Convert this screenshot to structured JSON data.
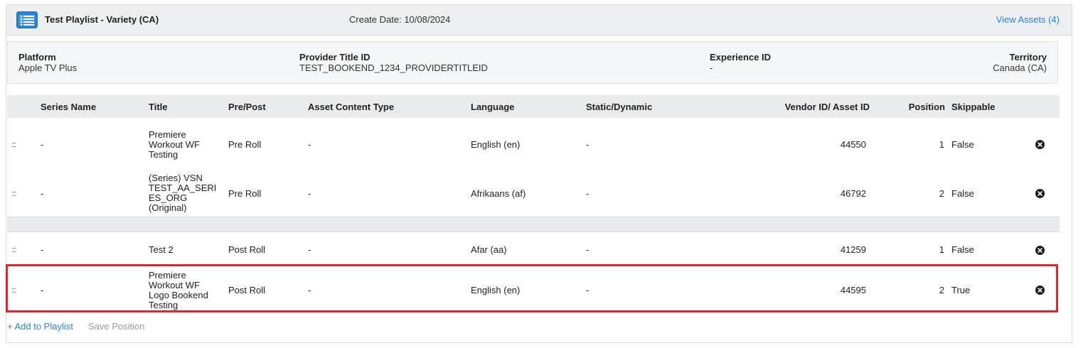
{
  "header": {
    "title": "Test Playlist - Variety (CA)",
    "create_date": "Create Date: 10/08/2024",
    "view_assets": "View Assets (4)",
    "icon": "list-icon",
    "accent_color": "#2a84d4"
  },
  "info": {
    "platform": {
      "label": "Platform",
      "value": "Apple TV Plus"
    },
    "provider_title_id": {
      "label": "Provider Title ID",
      "value": "TEST_BOOKEND_1234_PROVIDERTITLEID"
    },
    "experience_id": {
      "label": "Experience ID",
      "value": "-"
    },
    "territory": {
      "label": "Territory",
      "value": "Canada (CA)"
    }
  },
  "table": {
    "columns": {
      "series_name": "Series Name",
      "title": "Title",
      "pre_post": "Pre/Post",
      "asset_content_type": "Asset Content Type",
      "language": "Language",
      "static_dynamic": "Static/Dynamic",
      "vendor_asset_id": "Vendor ID/ Asset ID",
      "position": "Position",
      "skippable": "Skippable"
    },
    "rows": [
      {
        "handle": ":::",
        "series_name": "-",
        "title_lines": [
          "Premiere",
          "Workout WF",
          "Testing"
        ],
        "pre_post": "Pre Roll",
        "asset_content_type": "-",
        "language": "English (en)",
        "static_dynamic": "-",
        "vendor_asset_id": "44550",
        "position": "1",
        "skippable": "False"
      },
      {
        "handle": ":::",
        "series_name": "-",
        "title_lines": [
          "(Series) VSN",
          "TEST_AA_SERI",
          "ES_ORG",
          "(Original)"
        ],
        "pre_post": "Pre Roll",
        "asset_content_type": "-",
        "language": "Afrikaans (af)",
        "static_dynamic": "-",
        "vendor_asset_id": "46792",
        "position": "2",
        "skippable": "False"
      },
      {
        "handle": ":::",
        "series_name": "-",
        "title_lines": [
          "Test 2"
        ],
        "pre_post": "Post Roll",
        "asset_content_type": "-",
        "language": "Afar (aa)",
        "static_dynamic": "-",
        "vendor_asset_id": "41259",
        "position": "1",
        "skippable": "False"
      },
      {
        "handle": ":::",
        "series_name": "-",
        "title_lines": [
          "Premiere",
          "Workout WF",
          "Logo Bookend",
          "Testing"
        ],
        "pre_post": "Post Roll",
        "asset_content_type": "-",
        "language": "English (en)",
        "static_dynamic": "-",
        "vendor_asset_id": "44595",
        "position": "2",
        "skippable": "True"
      }
    ]
  },
  "footer": {
    "add_to_playlist": "+ Add to Playlist",
    "save_position": "Save Position"
  },
  "colors": {
    "highlight": "#e3242b",
    "header_bg": "#eceeef",
    "table_header_bg": "#e9ebed",
    "link": "#2a84d4",
    "disabled": "#9a9a9a"
  }
}
